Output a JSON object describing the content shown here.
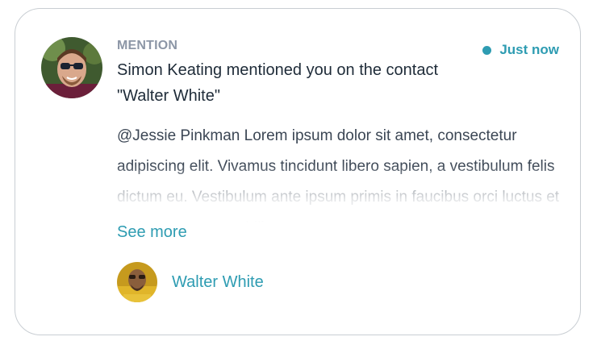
{
  "notification": {
    "type_label": "MENTION",
    "timestamp": "Just now",
    "headline": "Simon Keating mentioned you on the contact \"Walter White\"",
    "body": "@Jessie Pinkman Lorem ipsum dolor sit amet, consectetur adipiscing elit. Vivamus tincidunt libero sapien, a vestibulum felis dictum eu. Vestibulum ante ipsum primis in faucibus orci luctus et ultrices posuere cubilia curae.",
    "see_more_label": "See more",
    "contact_name": "Walter White"
  },
  "icons": {
    "author_avatar": "user-avatar-icon",
    "contact_avatar": "contact-avatar-icon",
    "unread_dot": "status-dot-icon"
  },
  "colors": {
    "accent": "#2e9cb2",
    "label": "#8c96a6",
    "text": "#1e2b38",
    "body": "#3b4654",
    "border": "#c9ced3"
  }
}
